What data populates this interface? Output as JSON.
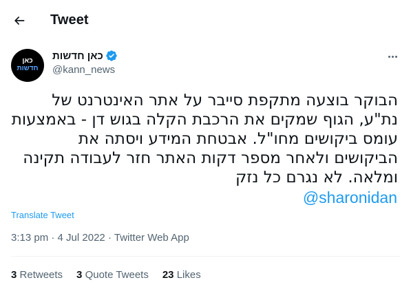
{
  "header": {
    "title": "Tweet",
    "back_icon": "arrow-left-icon"
  },
  "author": {
    "name": "כאן חדשות",
    "handle": "@kann_news",
    "verified": true,
    "avatar_logo_line1": "כאן",
    "avatar_logo_line2": "חדשות"
  },
  "tweet": {
    "text": "הבוקר בוצעה מתקפת סייבר על אתר האינטרנט של נת\"ע, הגוף שמקים את הרכבת הקלה בגוש דן - באמצעות עומס ביקושים מחו\"ל. אבטחת המידע ויסתה את הביקושים ולאחר מספר דקות האתר חזר לעבודה תקינה ומלאה. לא נגרם כל נזק",
    "mention": "@sharonidan",
    "translate_label": "Translate Tweet",
    "time": "3:13 pm",
    "date": "4 Jul 2022",
    "source": "Twitter Web App"
  },
  "stats": {
    "retweets_count": "3",
    "retweets_label": "Retweets",
    "quotes_count": "3",
    "quotes_label": "Quote Tweets",
    "likes_count": "23",
    "likes_label": "Likes"
  },
  "colors": {
    "accent": "#1d9bf0",
    "text": "#0f1419",
    "muted": "#536471",
    "border": "#eff3f4"
  }
}
